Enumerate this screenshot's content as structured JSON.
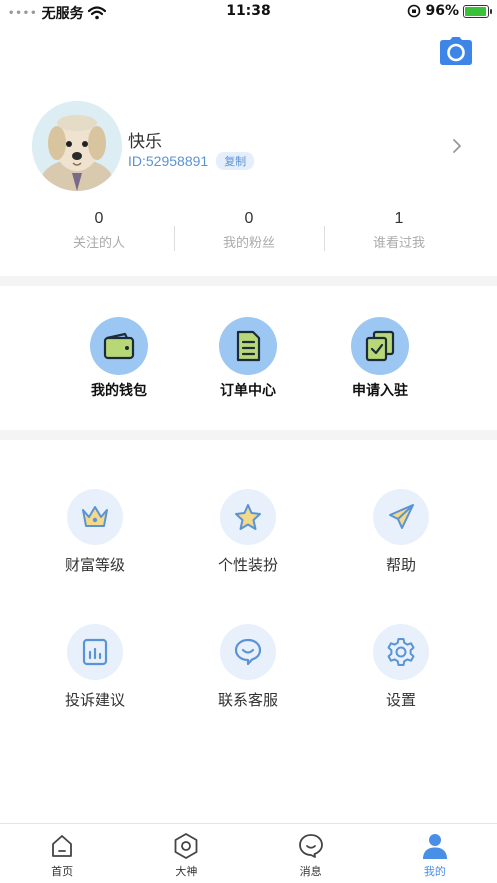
{
  "status_bar": {
    "carrier": "无服务",
    "time": "11:38",
    "battery": "96%",
    "battery_level": 0.96
  },
  "profile": {
    "nickname": "快乐",
    "id": "ID:52958891",
    "copy_label": "复制"
  },
  "stats": [
    {
      "value": "0",
      "label": "关注的人"
    },
    {
      "value": "0",
      "label": "我的粉丝"
    },
    {
      "value": "1",
      "label": "谁看过我"
    }
  ],
  "features": [
    {
      "label": "我的钱包",
      "icon": "wallet-icon"
    },
    {
      "label": "订单中心",
      "icon": "order-list-icon"
    },
    {
      "label": "申请入驻",
      "icon": "apply-icon"
    }
  ],
  "menu": [
    {
      "label": "财富等级",
      "icon": "crown-icon"
    },
    {
      "label": "个性装扮",
      "icon": "star-icon"
    },
    {
      "label": "帮助",
      "icon": "paper-plane-icon"
    },
    {
      "label": "投诉建议",
      "icon": "chart-icon"
    },
    {
      "label": "联系客服",
      "icon": "chat-icon"
    },
    {
      "label": "设置",
      "icon": "gear-icon"
    }
  ],
  "tabs": [
    {
      "label": "首页",
      "icon": "home-icon"
    },
    {
      "label": "大神",
      "icon": "hexagon-icon"
    },
    {
      "label": "消息",
      "icon": "message-icon"
    },
    {
      "label": "我的",
      "icon": "user-icon",
      "active": true
    }
  ],
  "colors": {
    "accent": "#4a8fe6",
    "feature_circle": "#9cc7f2",
    "menu_circle": "#e8f1fb",
    "id_text": "#5a93d6"
  }
}
